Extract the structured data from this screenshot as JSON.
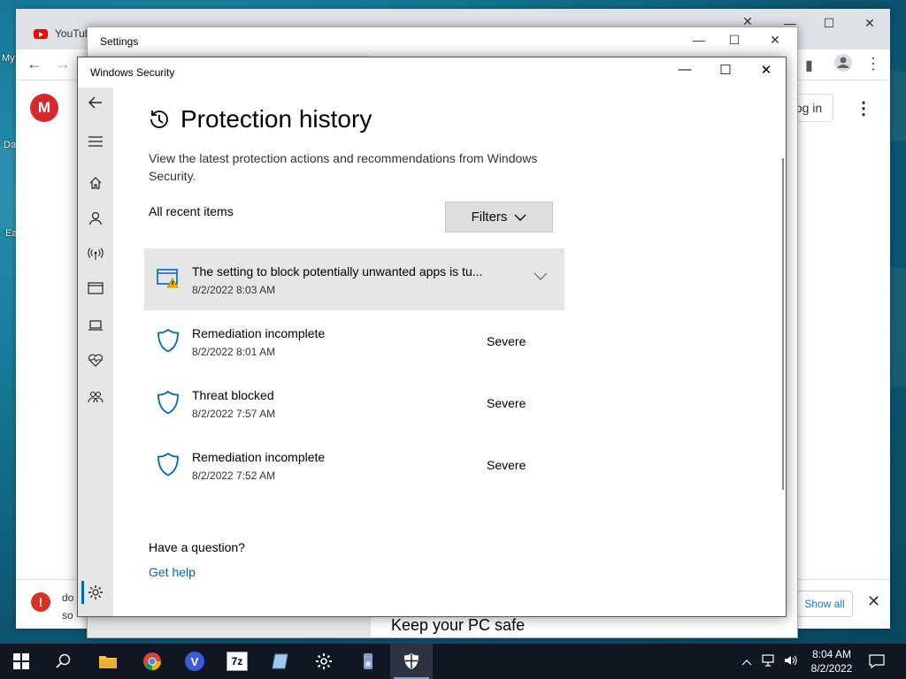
{
  "desktop": {
    "icon_labels": [
      "My",
      "Da",
      "Ea"
    ]
  },
  "browser": {
    "tab_title": "YouTub",
    "login_label": "og in",
    "download_line1": "do",
    "download_line2": "so",
    "show_all": "Show all",
    "mega_letter": "M",
    "error_glyph": "!"
  },
  "settings_window": {
    "title": "Settings",
    "bottom_text": "Keep your PC safe"
  },
  "security_window": {
    "title": "Windows Security",
    "page_title": "Protection history",
    "description": "View the latest protection actions and recommendations from Windows Security.",
    "section_label": "All recent items",
    "filters_label": "Filters",
    "items": [
      {
        "title": "The setting to block potentially unwanted apps is tu...",
        "time": "8/2/2022 8:03 AM",
        "severity": "",
        "icon": "warning-window-icon",
        "expanded_arrow": "chevron-down-icon"
      },
      {
        "title": "Remediation incomplete",
        "time": "8/2/2022 8:01 AM",
        "severity": "Severe",
        "icon": "shield-icon"
      },
      {
        "title": "Threat blocked",
        "time": "8/2/2022 7:57 AM",
        "severity": "Severe",
        "icon": "shield-icon"
      },
      {
        "title": "Remediation incomplete",
        "time": "8/2/2022 7:52 AM",
        "severity": "Severe",
        "icon": "shield-icon"
      }
    ],
    "question": "Have a question?",
    "help_link": "Get help",
    "nav_icons": [
      "back-arrow-icon",
      "menu-icon",
      "home-icon",
      "account-icon",
      "firewall-network-icon",
      "app-browser-control-icon",
      "device-security-icon",
      "device-health-icon",
      "family-options-icon",
      "settings-gear-icon"
    ]
  },
  "taskbar": {
    "apps": [
      "start-button",
      "search-icon",
      "file-explorer-icon",
      "chrome-icon",
      "vivaldi-icon",
      "7zip-icon",
      "notepad-icon",
      "settings-icon",
      "media-player-icon",
      "windows-security-icon"
    ],
    "vivaldi_letter": "V",
    "sevenzip_label": "7z",
    "time": "8:04 AM",
    "date": "8/2/2022"
  },
  "colors": {
    "accent": "#0067c0",
    "severe_shield": "#0067c0",
    "taskbar": "#101622"
  }
}
